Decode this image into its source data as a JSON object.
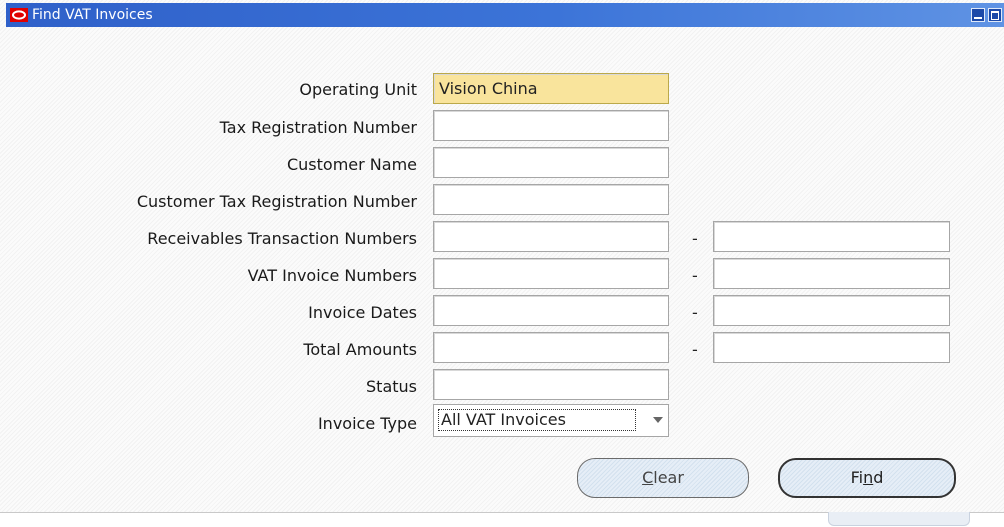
{
  "window": {
    "title": "Find VAT Invoices",
    "accent_color": "#3c74d8",
    "logo_color": "#e00000",
    "controls": [
      "minimize-icon",
      "maximize-icon",
      "close-icon"
    ]
  },
  "form": {
    "operating_unit": {
      "label": "Operating Unit",
      "value": "Vision China",
      "highlight_color": "#f9e49c"
    },
    "tax_registration_number": {
      "label": "Tax Registration Number",
      "value": ""
    },
    "customer_name": {
      "label": "Customer Name",
      "value": ""
    },
    "customer_tax_registration_number": {
      "label": "Customer Tax Registration Number",
      "value": ""
    },
    "receivables_transaction_numbers": {
      "label": "Receivables Transaction Numbers",
      "from": "",
      "separator": "-",
      "to": ""
    },
    "vat_invoice_numbers": {
      "label": "VAT Invoice Numbers",
      "from": "",
      "separator": "-",
      "to": ""
    },
    "invoice_dates": {
      "label": "Invoice Dates",
      "from": "",
      "separator": "-",
      "to": ""
    },
    "total_amounts": {
      "label": "Total Amounts",
      "from": "",
      "separator": "-",
      "to": ""
    },
    "status": {
      "label": "Status",
      "value": ""
    },
    "invoice_type": {
      "label": "Invoice Type",
      "selected": "All VAT Invoices"
    }
  },
  "buttons": {
    "clear": {
      "mnemonic": "C",
      "rest": "lear"
    },
    "find": {
      "pre": "Fi",
      "mnemonic": "n",
      "post": "d"
    }
  }
}
